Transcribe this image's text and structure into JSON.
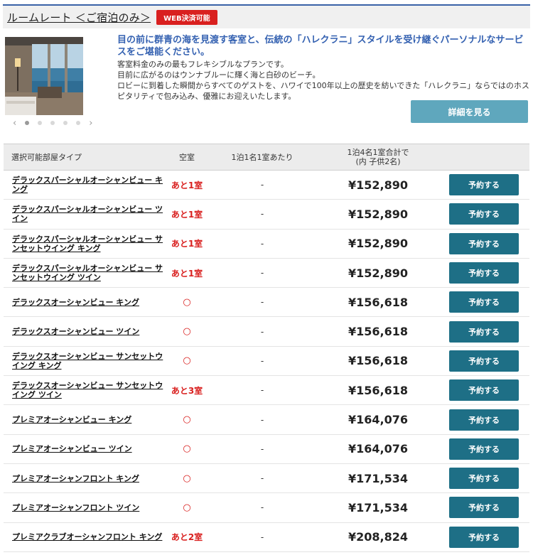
{
  "header": {
    "title": "ルームレート ＜ご宿泊のみ＞",
    "web_badge": "WEB決済可能"
  },
  "intro": {
    "lead": "目の前に群青の海を見渡す客室と、伝統の「ハレクラニ」スタイルを受け継ぐパーソナルなサービスをご堪能ください。",
    "lines": [
      "客室料金のみの最もフレキシブルなプランです。",
      "目前に広がるのはウンナブルーに輝く海と白砂のビーチ。",
      "ロビーに到着した瞬間からすべてのゲストを、ハワイで100年以上の歴史を紡いできた「ハレクラニ」ならではのホスピタリティで包み込み、優雅にお迎えいたします。"
    ],
    "detail_button": "詳細を見る"
  },
  "carousel": {
    "prev": "‹",
    "next": "›",
    "dot_count": 6,
    "active_index": 0
  },
  "table": {
    "headers": {
      "type": "選択可能部屋タイプ",
      "vacancy": "空室",
      "per_person": "1泊1名1室あたり",
      "total_line1": "1泊4名1室合計で",
      "total_line2": "(内 子供2名)"
    },
    "book_label": "予約する",
    "rows": [
      {
        "type": "デラックスパーシャルオーシャンビュー キング",
        "vacancy": "あと1室",
        "per": "-",
        "price": "¥152,890"
      },
      {
        "type": "デラックスパーシャルオーシャンビュー ツイン",
        "vacancy": "あと1室",
        "per": "-",
        "price": "¥152,890"
      },
      {
        "type": "デラックスパーシャルオーシャンビュー サンセットウイング キング",
        "vacancy": "あと1室",
        "per": "-",
        "price": "¥152,890"
      },
      {
        "type": "デラックスパーシャルオーシャンビュー サンセットウイング ツイン",
        "vacancy": "あと1室",
        "per": "-",
        "price": "¥152,890"
      },
      {
        "type": "デラックスオーシャンビュー キング",
        "vacancy": "○",
        "per": "-",
        "price": "¥156,618"
      },
      {
        "type": "デラックスオーシャンビュー ツイン",
        "vacancy": "○",
        "per": "-",
        "price": "¥156,618"
      },
      {
        "type": "デラックスオーシャンビュー サンセットウイング キング",
        "vacancy": "○",
        "per": "-",
        "price": "¥156,618"
      },
      {
        "type": "デラックスオーシャンビュー サンセットウイング ツイン",
        "vacancy": "あと3室",
        "per": "-",
        "price": "¥156,618"
      },
      {
        "type": "プレミアオーシャンビュー キング",
        "vacancy": "○",
        "per": "-",
        "price": "¥164,076"
      },
      {
        "type": "プレミアオーシャンビュー ツイン",
        "vacancy": "○",
        "per": "-",
        "price": "¥164,076"
      },
      {
        "type": "プレミアオーシャンフロント キング",
        "vacancy": "○",
        "per": "-",
        "price": "¥171,534"
      },
      {
        "type": "プレミアオーシャンフロント ツイン",
        "vacancy": "○",
        "per": "-",
        "price": "¥171,534"
      },
      {
        "type": "プレミアクラブオーシャンフロント キング",
        "vacancy": "あと2室",
        "per": "-",
        "price": "¥208,824"
      }
    ]
  },
  "colors": {
    "accent_blue": "#3461b1",
    "badge_red": "#d9201f",
    "book_button": "#1e6f86",
    "detail_button": "#5fa7bd"
  }
}
